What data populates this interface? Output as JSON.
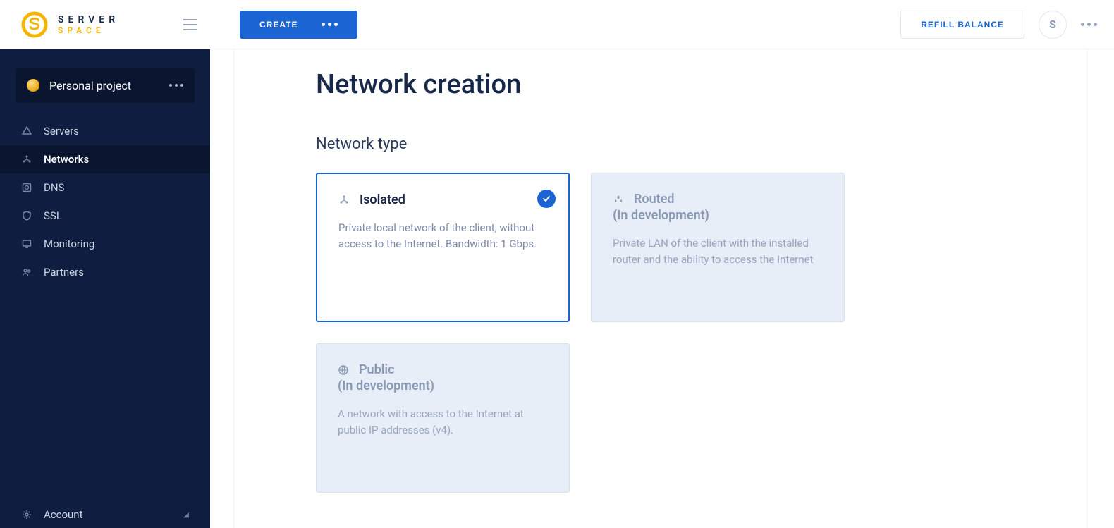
{
  "header": {
    "logo_top": "SERVER",
    "logo_bottom": "SPACE",
    "create_label": "CREATE",
    "refill_label": "REFILL BALANCE",
    "avatar_initial": "S"
  },
  "sidebar": {
    "project_label": "Personal project",
    "items": [
      {
        "label": "Servers"
      },
      {
        "label": "Networks"
      },
      {
        "label": "DNS"
      },
      {
        "label": "SSL"
      },
      {
        "label": "Monitoring"
      },
      {
        "label": "Partners"
      }
    ],
    "account_label": "Account"
  },
  "main": {
    "title": "Network creation",
    "section": "Network type",
    "cards": {
      "isolated": {
        "name": "Isolated",
        "desc": "Private local network of the client, without access to the Internet. Bandwidth: 1 Gbps."
      },
      "routed": {
        "name": "Routed",
        "dev": "(In development)",
        "desc": "Private LAN of the client with the installed router and the ability to access the Internet"
      },
      "public": {
        "name": "Public",
        "dev": "(In development)",
        "desc": "A network with access to the Internet at public IP addresses (v4)."
      }
    }
  }
}
